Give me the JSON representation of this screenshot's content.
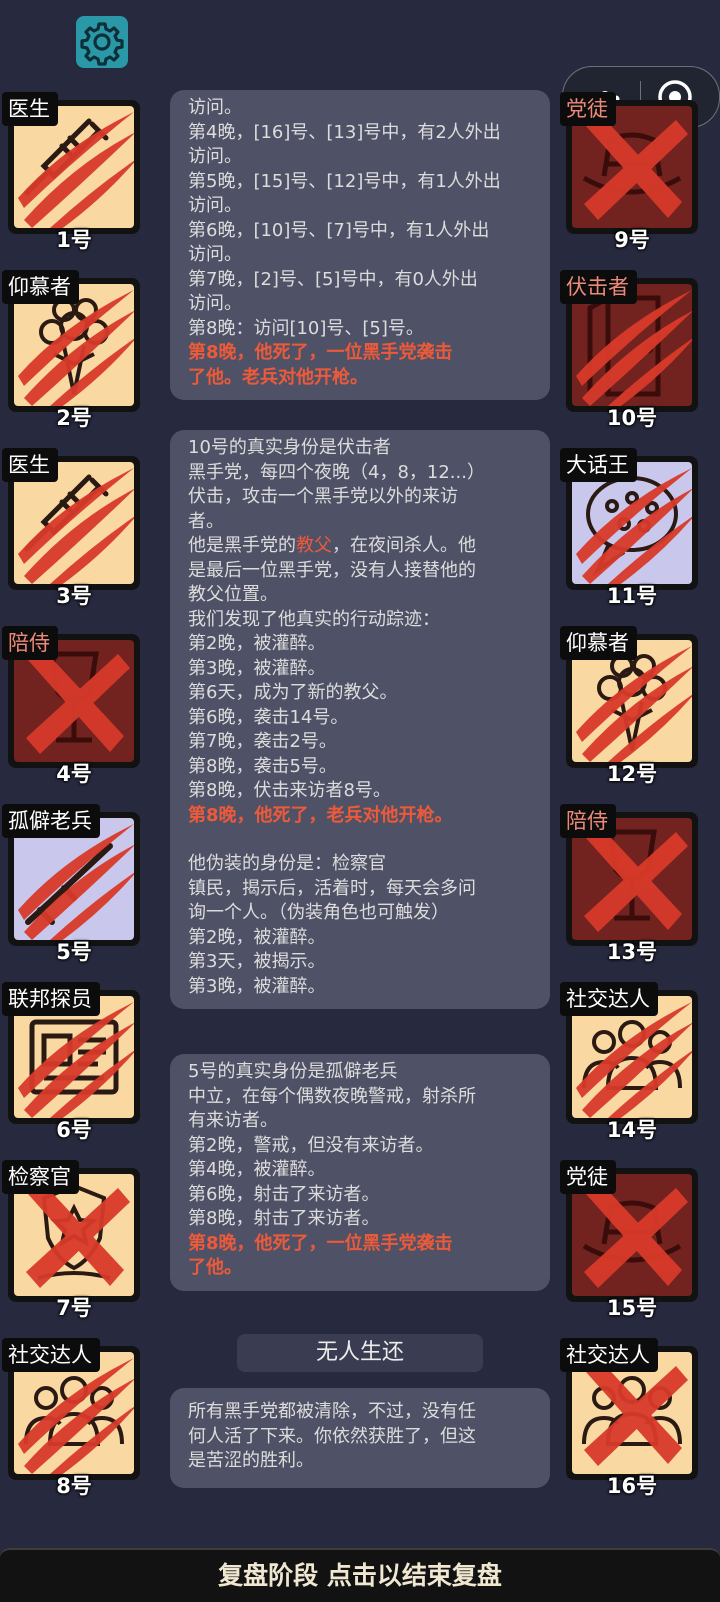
{
  "colors": {
    "background": "#272a3f",
    "settings_button": "#2b98a8",
    "panel": "#4f5266",
    "highlight_text": "#ec5a3a",
    "tile_beige": "#f9d8a1",
    "tile_lavender": "#c9c8ec",
    "tile_dead": "#72231f",
    "slash_red": "#d83a2a"
  },
  "header": {
    "settings_icon": "gear-icon",
    "capsule_more_icon": "more-dots-icon",
    "capsule_close_icon": "target-circle-icon"
  },
  "players_left": [
    {
      "role": "医生",
      "number": "1号",
      "illustration": "syringe-icon",
      "tile": "beige",
      "mark": "claw"
    },
    {
      "role": "仰慕者",
      "number": "2号",
      "illustration": "flower-bouquet-icon",
      "tile": "beige",
      "mark": "claw"
    },
    {
      "role": "医生",
      "number": "3号",
      "illustration": "syringe-icon",
      "tile": "beige",
      "mark": "claw"
    },
    {
      "role": "陪侍",
      "number": "4号",
      "illustration": "wine-glass-icon",
      "tile": "dead",
      "mark": "cross",
      "role_color": "#ec8a7a"
    },
    {
      "role": "孤僻老兵",
      "number": "5号",
      "illustration": "rifle-icon",
      "tile": "lavender",
      "mark": "claw"
    },
    {
      "role": "联邦探员",
      "number": "6号",
      "illustration": "id-badge-icon",
      "tile": "beige",
      "mark": "claw"
    },
    {
      "role": "检察官",
      "number": "7号",
      "illustration": "police-badge-icon",
      "tile": "beige",
      "mark": "cross"
    },
    {
      "role": "社交达人",
      "number": "8号",
      "illustration": "crowd-icon",
      "tile": "beige",
      "mark": "claw"
    }
  ],
  "players_right": [
    {
      "role": "党徒",
      "number": "9号",
      "illustration": "fedora-hat-icon",
      "tile": "dead",
      "mark": "cross",
      "role_color": "#ec8a7a"
    },
    {
      "role": "伏击者",
      "number": "10号",
      "illustration": "door-icon",
      "tile": "dead",
      "mark": "claw",
      "role_color": "#ec8a7a"
    },
    {
      "role": "大话王",
      "number": "11号",
      "illustration": "speech-bubble-icon",
      "tile": "lavender",
      "mark": "claw"
    },
    {
      "role": "仰慕者",
      "number": "12号",
      "illustration": "flower-bouquet-icon",
      "tile": "beige",
      "mark": "claw"
    },
    {
      "role": "陪侍",
      "number": "13号",
      "illustration": "wine-glass-icon",
      "tile": "dead",
      "mark": "cross",
      "role_color": "#ec8a7a"
    },
    {
      "role": "社交达人",
      "number": "14号",
      "illustration": "crowd-icon",
      "tile": "beige",
      "mark": "claw"
    },
    {
      "role": "党徒",
      "number": "15号",
      "illustration": "fedora-hat-icon",
      "tile": "dead",
      "mark": "cross"
    },
    {
      "role": "社交达人",
      "number": "16号",
      "illustration": "crowd-icon",
      "tile": "beige",
      "mark": "cross"
    }
  ],
  "panels": [
    {
      "lines": [
        {
          "text": "访问。"
        },
        {
          "text": "第4晚，[16]号、[13]号中，有2人外出"
        },
        {
          "text": "访问。"
        },
        {
          "text": "第5晚，[15]号、[12]号中，有1人外出"
        },
        {
          "text": "访问。"
        },
        {
          "text": "第6晚，[10]号、[7]号中，有1人外出"
        },
        {
          "text": "访问。"
        },
        {
          "text": "第7晚，[2]号、[5]号中，有0人外出"
        },
        {
          "text": "访问。"
        },
        {
          "text": "第8晚：访问[10]号、[5]号。"
        },
        {
          "text": "第8晚，他死了，一位黑手党袭击",
          "style": "hl"
        },
        {
          "text": "了他。老兵对他开枪。",
          "style": "hl"
        }
      ]
    },
    {
      "lines": [
        {
          "text": "10号的真实身份是伏击者"
        },
        {
          "text": "黑手党，每四个夜晚（4，8，12...）"
        },
        {
          "text": "伏击，攻击一个黑手党以外的来访"
        },
        {
          "text": "者。"
        },
        {
          "pre": "他是黑手党的",
          "kw": "教父",
          "post": "，在夜间杀人。他"
        },
        {
          "text": "是最后一位黑手党，没有人接替他的"
        },
        {
          "text": "教父位置。"
        },
        {
          "text": "我们发现了他真实的行动踪迹："
        },
        {
          "text": "第2晚，被灌醉。"
        },
        {
          "text": "第3晚，被灌醉。"
        },
        {
          "text": "第6天，成为了新的教父。"
        },
        {
          "text": "第6晚，袭击14号。"
        },
        {
          "text": "第7晚，袭击2号。"
        },
        {
          "text": "第8晚，袭击5号。"
        },
        {
          "text": "第8晚，伏击来访者8号。"
        },
        {
          "text": "第8晚，他死了，老兵对他开枪。",
          "style": "hl"
        },
        {
          "text": "",
          "style": "gap"
        },
        {
          "text": "他伪装的身份是：检察官"
        },
        {
          "text": "镇民，揭示后，活着时，每天会多问"
        },
        {
          "text": "询一个人。（伪装角色也可触发）"
        },
        {
          "text": "第2晚，被灌醉。"
        },
        {
          "text": "第3天，被揭示。"
        },
        {
          "text": "第3晚，被灌醉。"
        }
      ]
    },
    {
      "lines": [
        {
          "text": "5号的真实身份是孤僻老兵"
        },
        {
          "text": "中立，在每个偶数夜晚警戒，射杀所"
        },
        {
          "text": "有来访者。"
        },
        {
          "text": "第2晚，警戒，但没有来访者。"
        },
        {
          "text": "第4晚，被灌醉。"
        },
        {
          "text": "第6晚，射击了来访者。"
        },
        {
          "text": "第8晚，射击了来访者。"
        },
        {
          "text": "第8晚，他死了，一位黑手党袭击",
          "style": "hl"
        },
        {
          "text": "了他。",
          "style": "hl"
        }
      ]
    },
    {
      "lines": [
        {
          "text": "所有黑手党都被清除，不过，没有任"
        },
        {
          "text": "何人活了下来。你依然获胜了，但这"
        },
        {
          "text": "是苦涩的胜利。"
        }
      ]
    }
  ],
  "result_banner": "无人生还",
  "bottom_bar": "复盘阶段 点击以结束复盘"
}
